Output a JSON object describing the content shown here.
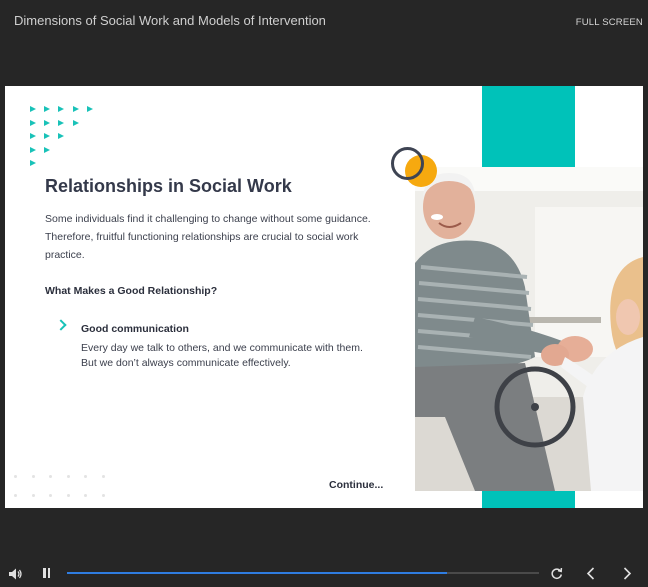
{
  "header": {
    "course_title": "Dimensions of Social Work and Models of Intervention",
    "fullscreen_label": "FULL SCREEN"
  },
  "slide": {
    "title": "Relationships in Social Work",
    "intro": "Some individuals find it challenging to change without some guidance. Therefore, fruitful functioning relationships are crucial to social work practice.",
    "subheading": "What Makes a Good Relationship?",
    "bullet": {
      "title": "Good communication",
      "text": "Every day we talk to others, and we communicate with them. But we don’t always communicate effectively."
    },
    "continue_label": "Continue..."
  },
  "colors": {
    "teal": "#00c2b9",
    "orange": "#f6a90f",
    "title_text": "#34394a",
    "progress": "#2f7de1",
    "background": "#262626"
  },
  "player": {
    "progress_fraction": 0.805,
    "icons": [
      "volume-icon",
      "pause-icon",
      "replay-icon",
      "chevron-left-icon",
      "chevron-right-icon"
    ]
  }
}
